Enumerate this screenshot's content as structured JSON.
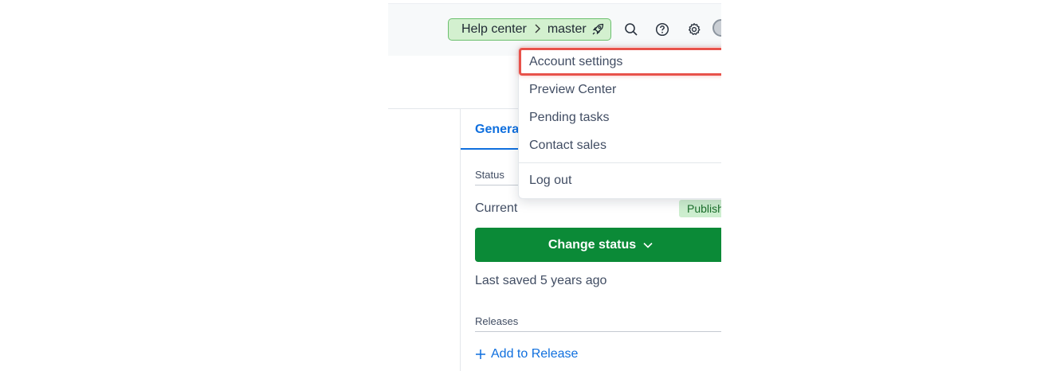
{
  "header": {
    "branch": {
      "environment": "Help center",
      "branch_name": "master"
    },
    "icons": [
      "search-icon",
      "help-icon",
      "gear-icon",
      "rocket-icon",
      "avatar"
    ]
  },
  "tabs": {
    "general_label": "General"
  },
  "sidebar": {
    "status_label": "Status",
    "current_label": "Current",
    "status_badge": "Published",
    "change_status_label": "Change status",
    "last_saved": "Last saved 5 years ago",
    "releases_label": "Releases",
    "add_to_release_label": "Add to Release"
  },
  "account_menu": {
    "items": [
      {
        "label": "Account settings"
      },
      {
        "label": "Preview Center"
      },
      {
        "label": "Pending tasks"
      },
      {
        "label": "Contact sales"
      },
      {
        "label": "Log out"
      }
    ]
  },
  "colors": {
    "accent": "#0f6fde",
    "primary_button": "#0b8a37",
    "branch_pill_bg": "#d3f0cf",
    "highlight": "#e8524a"
  }
}
